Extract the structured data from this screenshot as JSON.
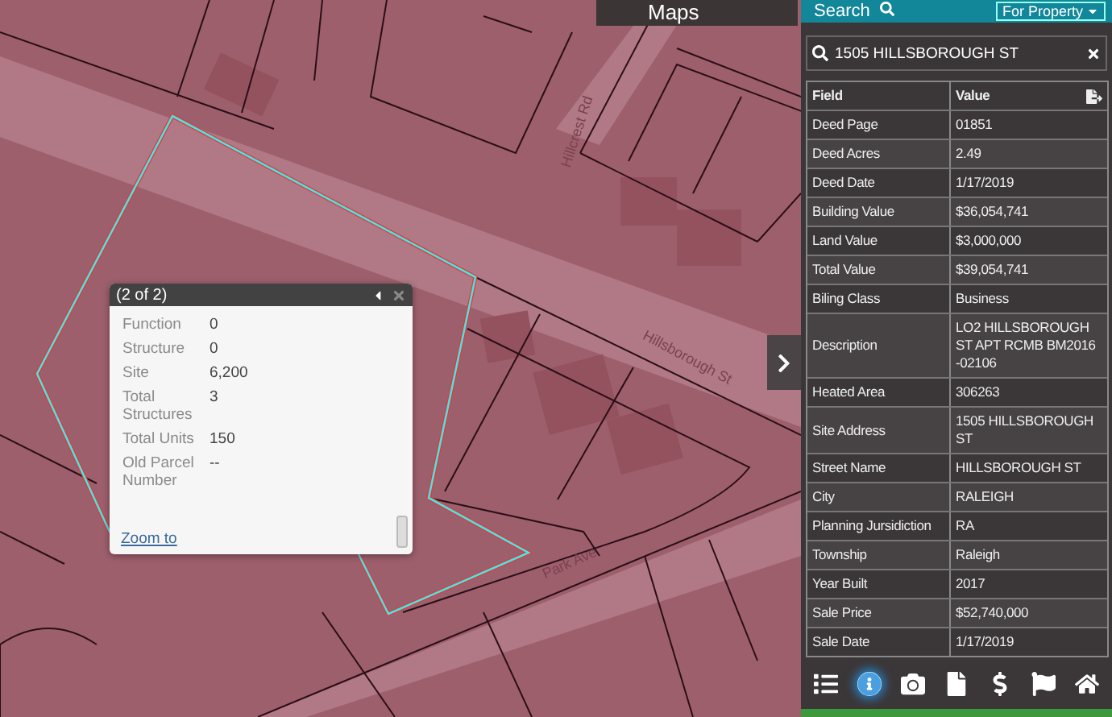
{
  "map": {
    "maps_button": "Maps",
    "street_labels": [
      {
        "text": "Hillcrest Rd",
        "kind": "vertical"
      },
      {
        "text": "Hillsborough St",
        "kind": "main"
      },
      {
        "text": "Park Ave",
        "kind": "park"
      }
    ]
  },
  "popup": {
    "title": "(2 of 2)",
    "fields": [
      {
        "label": "Function",
        "value": "0"
      },
      {
        "label": "Structure",
        "value": "0"
      },
      {
        "label": "Site",
        "value": "6,200"
      },
      {
        "label": "Total Structures",
        "value": "3"
      },
      {
        "label": "Total Units",
        "value": "150"
      },
      {
        "label": "Old Parcel Number",
        "value": "--"
      }
    ],
    "link": "Zoom to"
  },
  "panel": {
    "search_tab": "Search",
    "scope": "For Property",
    "search_value": "1505 HILLSBOROUGH ST",
    "columns": [
      "Field",
      "Value"
    ],
    "rows": [
      {
        "field": "Deed Page",
        "value": "01851"
      },
      {
        "field": "Deed Acres",
        "value": "2.49"
      },
      {
        "field": "Deed Date",
        "value": "1/17/2019"
      },
      {
        "field": "Building Value",
        "value": "$36,054,741"
      },
      {
        "field": "Land Value",
        "value": "$3,000,000"
      },
      {
        "field": "Total Value",
        "value": "$39,054,741"
      },
      {
        "field": "Biling Class",
        "value": "Business"
      },
      {
        "field": "Description",
        "value": "LO2 HILLSBOROUGH ST APT RCMB BM2016 -02106"
      },
      {
        "field": "Heated Area",
        "value": "306263"
      },
      {
        "field": "Site Address",
        "value": "1505 HILLSBOROUGH ST"
      },
      {
        "field": "Street Name",
        "value": "HILLSBOROUGH ST"
      },
      {
        "field": "City",
        "value": "RALEIGH"
      },
      {
        "field": "Planning Jursidiction",
        "value": "RA"
      },
      {
        "field": "Township",
        "value": "Raleigh"
      },
      {
        "field": "Year Built",
        "value": "2017"
      },
      {
        "field": "Sale Price",
        "value": "$52,740,000"
      },
      {
        "field": "Sale Date",
        "value": "1/17/2019"
      }
    ],
    "tools": [
      {
        "kind": "list",
        "selected": false
      },
      {
        "kind": "info",
        "selected": true
      },
      {
        "kind": "camera",
        "selected": false
      },
      {
        "kind": "file",
        "selected": false
      },
      {
        "kind": "dollar",
        "selected": false
      },
      {
        "kind": "flag",
        "selected": false
      },
      {
        "kind": "home",
        "selected": false
      }
    ]
  }
}
